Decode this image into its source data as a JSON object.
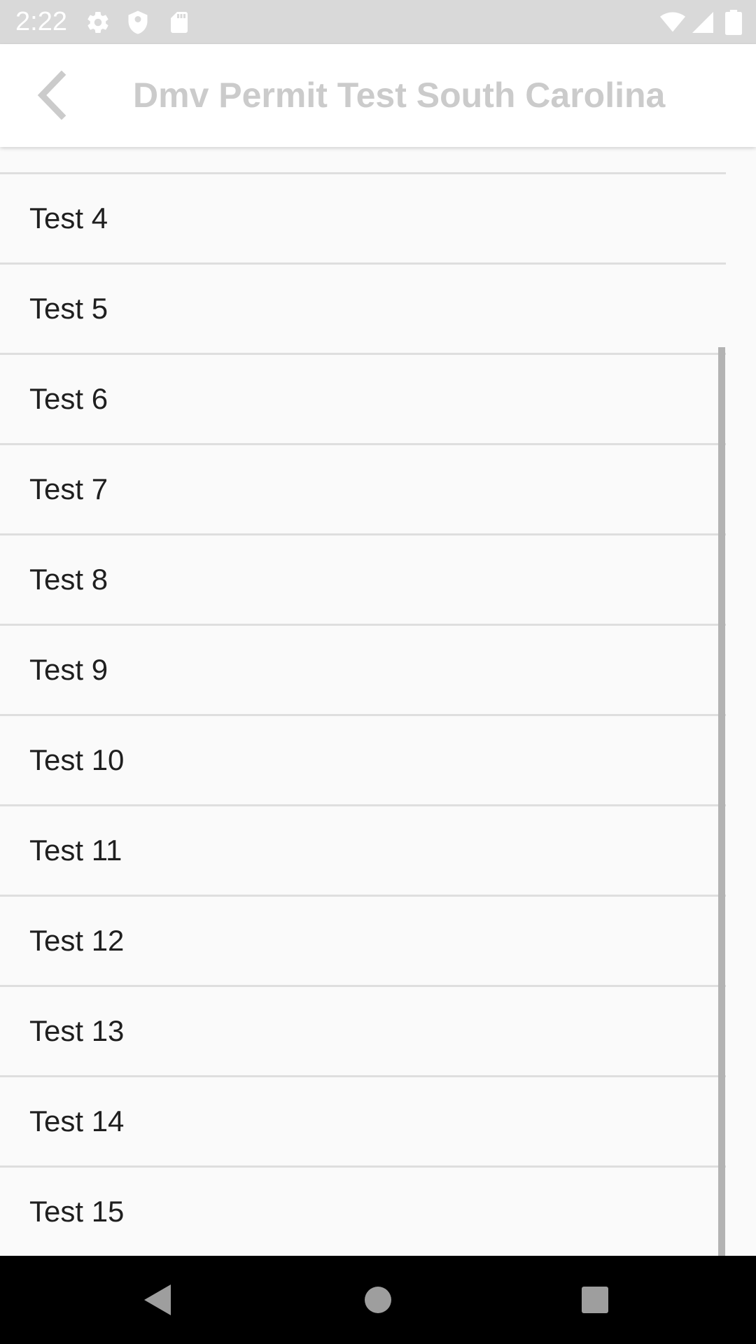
{
  "status_bar": {
    "time": "2:22",
    "icons": [
      "settings-icon",
      "shield-icon",
      "sd-card-icon",
      "wifi-icon",
      "signal-icon",
      "battery-icon"
    ]
  },
  "app_bar": {
    "title": "Dmv Permit Test South Carolina",
    "back_icon": "chevron-left-icon"
  },
  "list": {
    "items": [
      {
        "label": "Test 4"
      },
      {
        "label": "Test 5"
      },
      {
        "label": "Test 6"
      },
      {
        "label": "Test 7"
      },
      {
        "label": "Test 8"
      },
      {
        "label": "Test 9"
      },
      {
        "label": "Test 10"
      },
      {
        "label": "Test 11"
      },
      {
        "label": "Test 12"
      },
      {
        "label": "Test 13"
      },
      {
        "label": "Test 14"
      },
      {
        "label": "Test 15"
      }
    ]
  },
  "nav_bar": {
    "icons": [
      "back-triangle-icon",
      "home-circle-icon",
      "recents-square-icon"
    ]
  },
  "colors": {
    "status_bar_bg": "#d9d9d9",
    "app_bar_bg": "#ffffff",
    "title_text": "#cbcbcb",
    "list_bg": "#fafafa",
    "divider": "#dedede",
    "item_text": "#1f1f1f",
    "scrollbar": "#b3b3b3",
    "nav_bar_bg": "#000000",
    "nav_icon": "#9e9e9e"
  }
}
